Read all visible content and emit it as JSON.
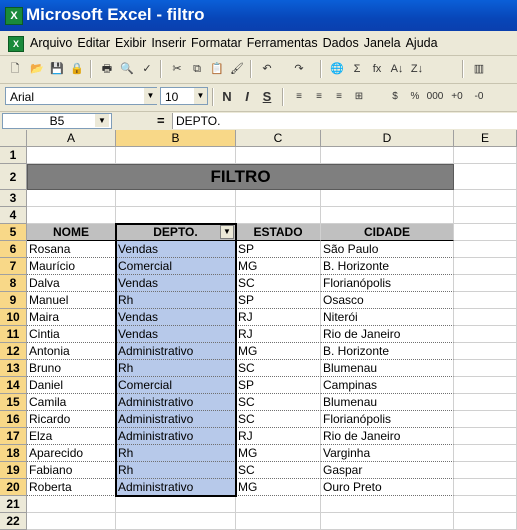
{
  "app": {
    "title": "Microsoft Excel - filtro"
  },
  "menu": [
    "Arquivo",
    "Editar",
    "Exibir",
    "Inserir",
    "Formatar",
    "Ferramentas",
    "Dados",
    "Janela",
    "Ajuda"
  ],
  "toolbar_std": [
    "new-icon",
    "open-icon",
    "save-icon",
    "permission-icon",
    "print-icon",
    "print-preview-icon",
    "spelling-icon",
    "cut-icon",
    "copy-icon",
    "paste-icon",
    "format-painter-icon",
    "undo-icon",
    "redo-icon",
    "hyperlink-icon",
    "autosum-icon",
    "function-icon",
    "sort-ascending-icon",
    "sort-descending-icon",
    "chart-icon"
  ],
  "toolbar_std_glyphs": [
    "🗋",
    "📂",
    "💾",
    "🔒",
    "🖶",
    "🔍",
    "✓",
    "✂",
    "⧉",
    "📋",
    "🖌",
    "↶",
    "↷",
    "🌐",
    "Σ",
    "fx",
    "A↓",
    "Z↓",
    "▥"
  ],
  "format": {
    "font": "Arial",
    "size": "10",
    "bold": "N",
    "italic": "I",
    "underline": "S",
    "buttons": [
      "align-left-icon",
      "align-center-icon",
      "align-right-icon",
      "merge-center-icon",
      "currency-icon",
      "percent-icon",
      "thousands-icon",
      "increase-decimal-icon",
      "decrease-decimal-icon"
    ],
    "button_glyphs": [
      "≡",
      "≡",
      "≡",
      "⊞",
      "$",
      "%",
      "000",
      "+0",
      "-0"
    ]
  },
  "formula": {
    "namebox": "B5",
    "eq": "=",
    "content": "DEPTO."
  },
  "columns": [
    "A",
    "B",
    "C",
    "D",
    "E"
  ],
  "sheet": {
    "title": "FILTRO",
    "headers": [
      "NOME",
      "DEPTO.",
      "ESTADO",
      "CIDADE"
    ],
    "records": [
      [
        "Rosana",
        "Vendas",
        "SP",
        "São Paulo"
      ],
      [
        "Maurício",
        "Comercial",
        "MG",
        "B. Horizonte"
      ],
      [
        "Dalva",
        "Vendas",
        "SC",
        "Florianópolis"
      ],
      [
        "Manuel",
        "Rh",
        "SP",
        "Osasco"
      ],
      [
        "Maira",
        "Vendas",
        "RJ",
        "Niterói"
      ],
      [
        "Cintia",
        "Vendas",
        "RJ",
        "Rio de Janeiro"
      ],
      [
        "Antonia",
        "Administrativo",
        "MG",
        "B. Horizonte"
      ],
      [
        "Bruno",
        "Rh",
        "SC",
        "Blumenau"
      ],
      [
        "Daniel",
        "Comercial",
        "SP",
        "Campinas"
      ],
      [
        "Camila",
        "Administrativo",
        "SC",
        "Blumenau"
      ],
      [
        "Ricardo",
        "Administrativo",
        "SC",
        "Florianópolis"
      ],
      [
        "Elza",
        "Administrativo",
        "RJ",
        "Rio de Janeiro"
      ],
      [
        "Aparecido",
        "Rh",
        "MG",
        "Varginha"
      ],
      [
        "Fabiano",
        "Rh",
        "SC",
        "Gaspar"
      ],
      [
        "Roberta",
        "Administrativo",
        "MG",
        "Ouro Preto"
      ]
    ]
  },
  "row_numbers": [
    "1",
    "2",
    "3",
    "4",
    "5",
    "6",
    "7",
    "8",
    "9",
    "10",
    "11",
    "12",
    "13",
    "14",
    "15",
    "16",
    "17",
    "18",
    "19",
    "20",
    "21",
    "22"
  ],
  "colors": {
    "title_bar": "#0a5fd8",
    "selection": "#b7c9ea",
    "header_fill": "#c0c0c0",
    "title_band": "#7f7f7f"
  }
}
